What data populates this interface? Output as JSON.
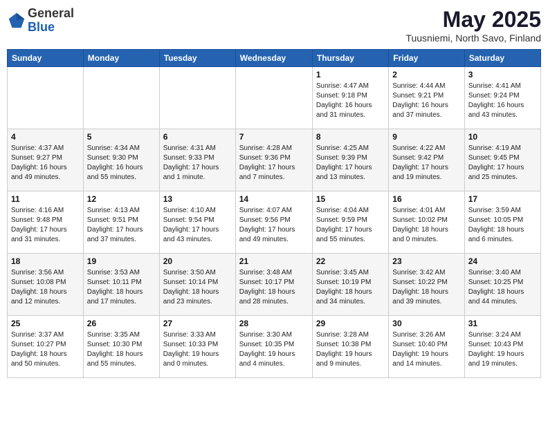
{
  "header": {
    "logo_general": "General",
    "logo_blue": "Blue",
    "month_title": "May 2025",
    "subtitle": "Tuusniemi, North Savo, Finland"
  },
  "days_of_week": [
    "Sunday",
    "Monday",
    "Tuesday",
    "Wednesday",
    "Thursday",
    "Friday",
    "Saturday"
  ],
  "weeks": [
    [
      {
        "day": "",
        "info": ""
      },
      {
        "day": "",
        "info": ""
      },
      {
        "day": "",
        "info": ""
      },
      {
        "day": "",
        "info": ""
      },
      {
        "day": "1",
        "info": "Sunrise: 4:47 AM\nSunset: 9:18 PM\nDaylight: 16 hours\nand 31 minutes."
      },
      {
        "day": "2",
        "info": "Sunrise: 4:44 AM\nSunset: 9:21 PM\nDaylight: 16 hours\nand 37 minutes."
      },
      {
        "day": "3",
        "info": "Sunrise: 4:41 AM\nSunset: 9:24 PM\nDaylight: 16 hours\nand 43 minutes."
      }
    ],
    [
      {
        "day": "4",
        "info": "Sunrise: 4:37 AM\nSunset: 9:27 PM\nDaylight: 16 hours\nand 49 minutes."
      },
      {
        "day": "5",
        "info": "Sunrise: 4:34 AM\nSunset: 9:30 PM\nDaylight: 16 hours\nand 55 minutes."
      },
      {
        "day": "6",
        "info": "Sunrise: 4:31 AM\nSunset: 9:33 PM\nDaylight: 17 hours\nand 1 minute."
      },
      {
        "day": "7",
        "info": "Sunrise: 4:28 AM\nSunset: 9:36 PM\nDaylight: 17 hours\nand 7 minutes."
      },
      {
        "day": "8",
        "info": "Sunrise: 4:25 AM\nSunset: 9:39 PM\nDaylight: 17 hours\nand 13 minutes."
      },
      {
        "day": "9",
        "info": "Sunrise: 4:22 AM\nSunset: 9:42 PM\nDaylight: 17 hours\nand 19 minutes."
      },
      {
        "day": "10",
        "info": "Sunrise: 4:19 AM\nSunset: 9:45 PM\nDaylight: 17 hours\nand 25 minutes."
      }
    ],
    [
      {
        "day": "11",
        "info": "Sunrise: 4:16 AM\nSunset: 9:48 PM\nDaylight: 17 hours\nand 31 minutes."
      },
      {
        "day": "12",
        "info": "Sunrise: 4:13 AM\nSunset: 9:51 PM\nDaylight: 17 hours\nand 37 minutes."
      },
      {
        "day": "13",
        "info": "Sunrise: 4:10 AM\nSunset: 9:54 PM\nDaylight: 17 hours\nand 43 minutes."
      },
      {
        "day": "14",
        "info": "Sunrise: 4:07 AM\nSunset: 9:56 PM\nDaylight: 17 hours\nand 49 minutes."
      },
      {
        "day": "15",
        "info": "Sunrise: 4:04 AM\nSunset: 9:59 PM\nDaylight: 17 hours\nand 55 minutes."
      },
      {
        "day": "16",
        "info": "Sunrise: 4:01 AM\nSunset: 10:02 PM\nDaylight: 18 hours\nand 0 minutes."
      },
      {
        "day": "17",
        "info": "Sunrise: 3:59 AM\nSunset: 10:05 PM\nDaylight: 18 hours\nand 6 minutes."
      }
    ],
    [
      {
        "day": "18",
        "info": "Sunrise: 3:56 AM\nSunset: 10:08 PM\nDaylight: 18 hours\nand 12 minutes."
      },
      {
        "day": "19",
        "info": "Sunrise: 3:53 AM\nSunset: 10:11 PM\nDaylight: 18 hours\nand 17 minutes."
      },
      {
        "day": "20",
        "info": "Sunrise: 3:50 AM\nSunset: 10:14 PM\nDaylight: 18 hours\nand 23 minutes."
      },
      {
        "day": "21",
        "info": "Sunrise: 3:48 AM\nSunset: 10:17 PM\nDaylight: 18 hours\nand 28 minutes."
      },
      {
        "day": "22",
        "info": "Sunrise: 3:45 AM\nSunset: 10:19 PM\nDaylight: 18 hours\nand 34 minutes."
      },
      {
        "day": "23",
        "info": "Sunrise: 3:42 AM\nSunset: 10:22 PM\nDaylight: 18 hours\nand 39 minutes."
      },
      {
        "day": "24",
        "info": "Sunrise: 3:40 AM\nSunset: 10:25 PM\nDaylight: 18 hours\nand 44 minutes."
      }
    ],
    [
      {
        "day": "25",
        "info": "Sunrise: 3:37 AM\nSunset: 10:27 PM\nDaylight: 18 hours\nand 50 minutes."
      },
      {
        "day": "26",
        "info": "Sunrise: 3:35 AM\nSunset: 10:30 PM\nDaylight: 18 hours\nand 55 minutes."
      },
      {
        "day": "27",
        "info": "Sunrise: 3:33 AM\nSunset: 10:33 PM\nDaylight: 19 hours\nand 0 minutes."
      },
      {
        "day": "28",
        "info": "Sunrise: 3:30 AM\nSunset: 10:35 PM\nDaylight: 19 hours\nand 4 minutes."
      },
      {
        "day": "29",
        "info": "Sunrise: 3:28 AM\nSunset: 10:38 PM\nDaylight: 19 hours\nand 9 minutes."
      },
      {
        "day": "30",
        "info": "Sunrise: 3:26 AM\nSunset: 10:40 PM\nDaylight: 19 hours\nand 14 minutes."
      },
      {
        "day": "31",
        "info": "Sunrise: 3:24 AM\nSunset: 10:43 PM\nDaylight: 19 hours\nand 19 minutes."
      }
    ]
  ]
}
